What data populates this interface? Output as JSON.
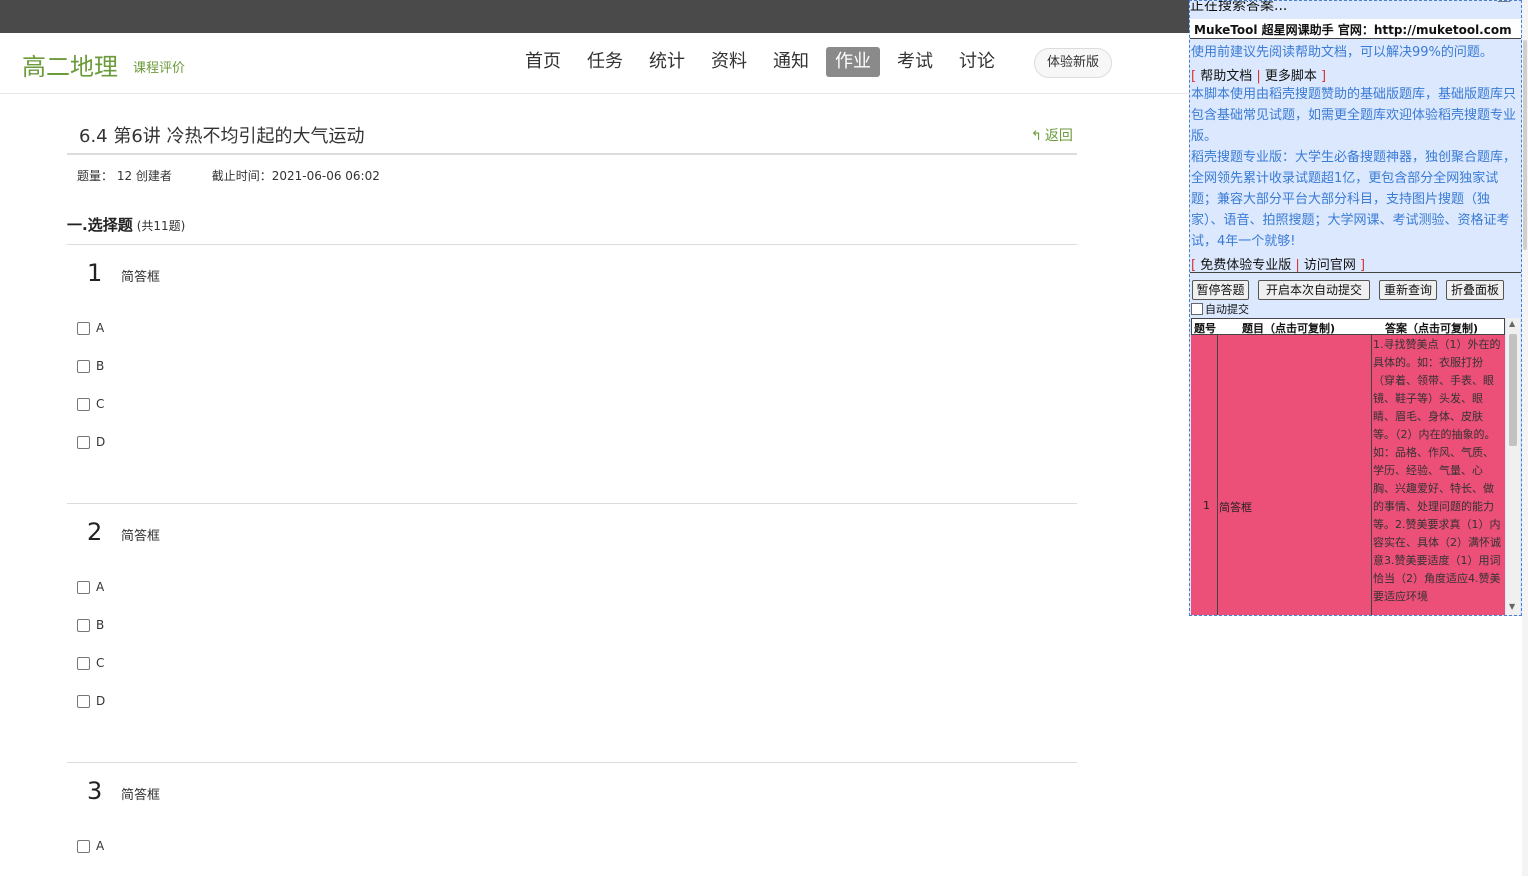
{
  "header": {
    "course_title": "高二地理",
    "course_eval": "课程评价",
    "nav": [
      "首页",
      "任务",
      "统计",
      "资料",
      "通知",
      "作业",
      "考试",
      "讨论"
    ],
    "active_nav": "作业",
    "new_version_button": "体验新版"
  },
  "homework": {
    "title": "6.4 第6讲 冷热不均引起的大气运动",
    "back_label": "返回",
    "meta_count": "题量：  12 创建者",
    "meta_deadline": "截止时间：2021-06-06 06:02",
    "section_title": "一.选择题",
    "section_count": "(共11题)",
    "questions": [
      {
        "num": "1",
        "label": "简答框",
        "options": [
          "A",
          "B",
          "C",
          "D"
        ]
      },
      {
        "num": "2",
        "label": "简答框",
        "options": [
          "A",
          "B",
          "C",
          "D"
        ]
      },
      {
        "num": "3",
        "label": "简答框",
        "options": [
          "A"
        ]
      }
    ]
  },
  "panel": {
    "status": "正在搜索答案...",
    "minimize": "—",
    "brand": "MukeTool 超星网课助手 官网：http://muketool.com",
    "notice": "使用前建议先阅读帮助文档，可以解决99%的问题。",
    "links1": [
      "帮助文档",
      "更多脚本"
    ],
    "info1": "本脚本使用由稻壳搜题赞助的基础版题库，基础版题库只包含基础常见试题，如需更全题库欢迎体验稻壳搜题专业版。",
    "info2": "稻壳搜题专业版：大学生必备搜题神器，独创聚合题库，全网领先累计收录试题超1亿，更包含部分全网独家试题；兼容大部分平台大部分科目，支持图片搜题（独家）、语音、拍照搜题；大学网课、考试测验、资格证考试，4年一个就够!",
    "links2": [
      "免费体验专业版",
      "访问官网"
    ],
    "buttons": [
      "暂停答题",
      "开启本次自动提交",
      "重新查询",
      "折叠面板"
    ],
    "auto_submit": "自动提交",
    "table": {
      "headers": [
        "题号",
        "题目（点击可复制)",
        "答案（点击可复制)"
      ],
      "row": {
        "num": "1",
        "question": "简答框",
        "answer": "1.寻找赞美点（1）外在的具体的。如：衣服打扮（穿着、领带、手表、眼镜、鞋子等）头发、眼睛、眉毛、身体、皮肤等。（2）内在的抽象的。如：品格、作风、气质、学历、经验、气量、心胸、兴趣爱好、特长、做的事情、处理问题的能力等。2.赞美要求真（1）内容实在、具体（2）满怀诚意3.赞美要适度（1）用词恰当（2）角度适应4.赞美要适应环境"
      }
    }
  }
}
